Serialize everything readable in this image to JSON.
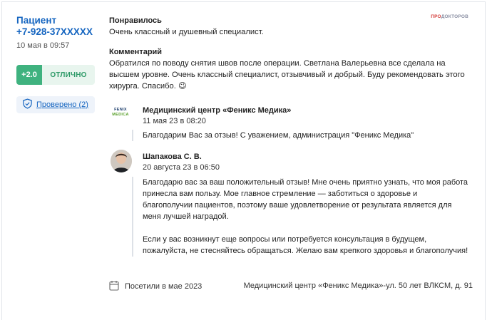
{
  "patient": {
    "name": "Пациент",
    "phone": "+7-928-37XXXXX",
    "date": "10 мая в 09:57"
  },
  "rating": {
    "score": "+2.0",
    "label": "ОТЛИЧНО",
    "colors": {
      "score_bg": "#3fb27f",
      "label_bg": "#e8f5ee",
      "label_text": "#2e9a68"
    }
  },
  "verified": {
    "label": "Проверено (2)",
    "icon": "shield-check-icon"
  },
  "brand": {
    "part1": "ПРО",
    "part2": "ДОКТОРОВ"
  },
  "review": {
    "liked_title": "Понравилось",
    "liked_text": "Очень классный и душевный специалист.",
    "comment_title": "Комментарий",
    "comment_text": "Обратился по поводу снятия швов после операции. Светлана Валерьевна все сделала на высшем уровне. Очень классный специалист, отзывчивый и добрый. Буду рекомендовать этого хирурга. Спасибо. 😉"
  },
  "replies": [
    {
      "logo_line1": "FENIX",
      "logo_line2": "MEDICA",
      "author": "Медицинский центр «Феникс Медика»",
      "date": "11 мая 23 в 08:20",
      "paragraphs": [
        "Благодарим Вас за отзыв! С уважением, администрация \"Феникс Медика\""
      ]
    },
    {
      "author": "Шапакова С. В.",
      "date": "20 августа 23 в 06:50",
      "paragraphs": [
        "Благодарю вас за ваш положительный отзыв! Мне очень приятно узнать, что моя работа принесла вам пользу. Мое главное стремление — заботиться о здоровье и благополучии пациентов, поэтому ваше удовлетворение от результата является для меня лучшей наградой.",
        "Если у вас возникнут еще вопросы или потребуется консультация в будущем, пожалуйста, не стесняйтесь обращаться. Желаю вам крепкого здоровья и благополучия!"
      ]
    }
  ],
  "footer": {
    "visit": "Посетили в мае 2023",
    "address": "Медицинский центр «Феникс Медика»-ул. 50 лет ВЛКСМ, д. 91"
  }
}
